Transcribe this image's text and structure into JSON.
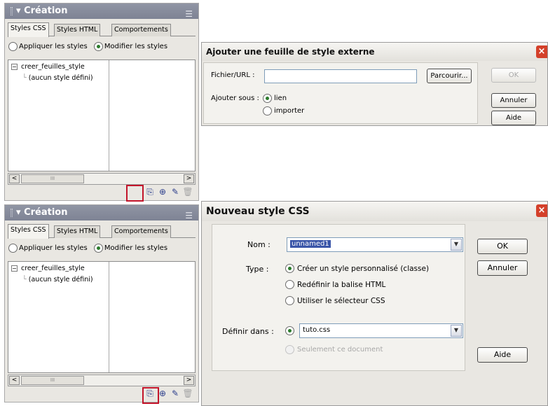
{
  "panel": {
    "title": "Création",
    "tabs": [
      "Styles CSS",
      "Styles HTML",
      "Comportements"
    ],
    "radio_apply": "Appliquer les styles",
    "radio_modify": "Modifier les styles",
    "tree_root": "creer_feuilles_style",
    "tree_child": "(aucun style défini)",
    "plus_glyph": "−",
    "scroll_left": "<",
    "scroll_right": ">",
    "scroll_thumb": "III"
  },
  "dialog_external": {
    "title": "Ajouter une feuille de style externe",
    "file_label": "Fichier/URL :",
    "file_value": "",
    "browse_button": "Parcourir...",
    "add_as_label": "Ajouter sous :",
    "option_link": "lien",
    "option_import": "importer",
    "ok_button": "OK",
    "cancel_button": "Annuler",
    "help_button": "Aide"
  },
  "dialog_new_style": {
    "title": "Nouveau style CSS",
    "name_label": "Nom :",
    "name_value": "unnamed1",
    "type_label": "Type :",
    "type_options": [
      "Créer un style personnalisé (classe)",
      "Redéfinir la balise HTML",
      "Utiliser le sélecteur CSS"
    ],
    "define_label": "Définir dans :",
    "define_value": "tuto.css",
    "only_this_doc": "Seulement ce document",
    "ok_button": "OK",
    "cancel_button": "Annuler",
    "help_button": "Aide"
  },
  "colors": {
    "highlight": "#c3152b",
    "title_bar": "#8a8f9f"
  }
}
